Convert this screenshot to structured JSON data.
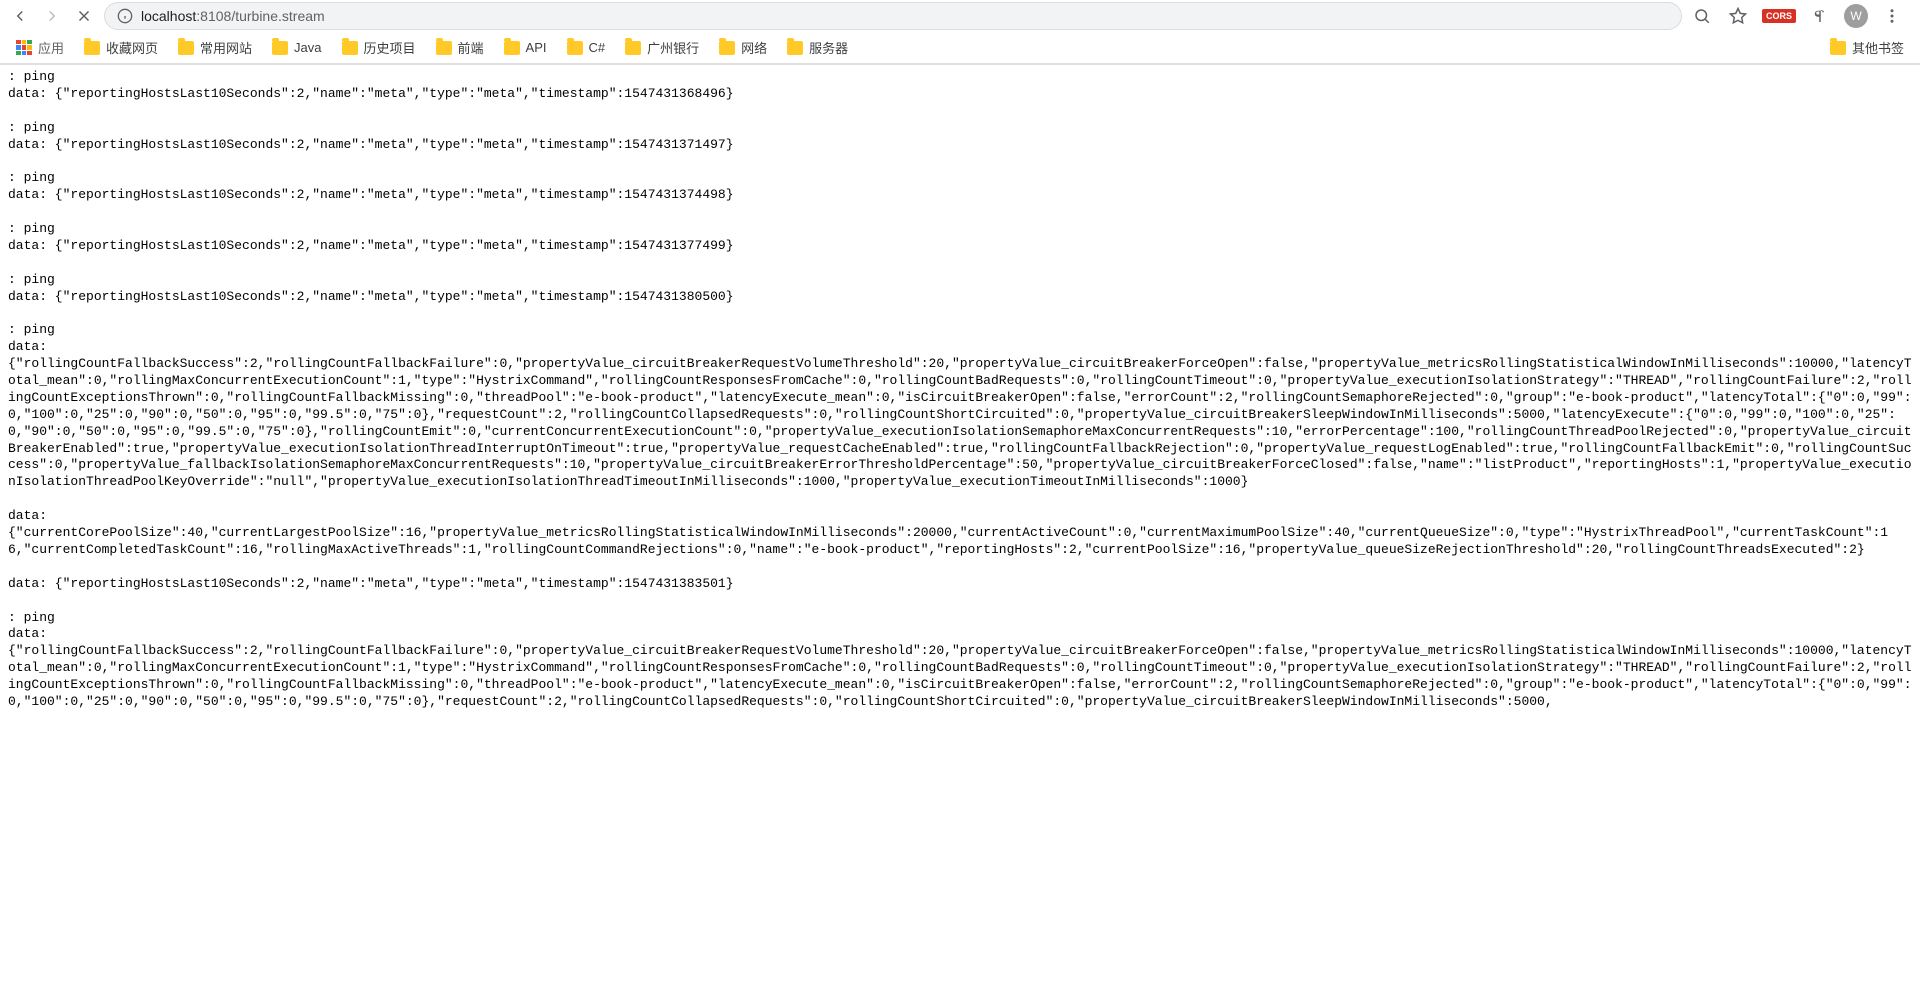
{
  "url": {
    "host": "localhost",
    "port": ":8108",
    "path": "/turbine.stream"
  },
  "toolbar": {
    "cors_label": "CORS",
    "avatar_letter": "W"
  },
  "bookmarks": {
    "apps_label": "应用",
    "items": [
      {
        "label": "收藏网页"
      },
      {
        "label": "常用网站"
      },
      {
        "label": "Java"
      },
      {
        "label": "历史项目"
      },
      {
        "label": "前端"
      },
      {
        "label": "API"
      },
      {
        "label": "C#"
      },
      {
        "label": "广州银行"
      },
      {
        "label": "网络"
      },
      {
        "label": "服务器"
      }
    ],
    "other_label": "其他书签"
  },
  "stream": {
    "lines": [
      ": ping",
      "data: {\"reportingHostsLast10Seconds\":2,\"name\":\"meta\",\"type\":\"meta\",\"timestamp\":1547431368496}",
      "",
      ": ping",
      "data: {\"reportingHostsLast10Seconds\":2,\"name\":\"meta\",\"type\":\"meta\",\"timestamp\":1547431371497}",
      "",
      ": ping",
      "data: {\"reportingHostsLast10Seconds\":2,\"name\":\"meta\",\"type\":\"meta\",\"timestamp\":1547431374498}",
      "",
      ": ping",
      "data: {\"reportingHostsLast10Seconds\":2,\"name\":\"meta\",\"type\":\"meta\",\"timestamp\":1547431377499}",
      "",
      ": ping",
      "data: {\"reportingHostsLast10Seconds\":2,\"name\":\"meta\",\"type\":\"meta\",\"timestamp\":1547431380500}",
      "",
      ": ping",
      "data:",
      "{\"rollingCountFallbackSuccess\":2,\"rollingCountFallbackFailure\":0,\"propertyValue_circuitBreakerRequestVolumeThreshold\":20,\"propertyValue_circuitBreakerForceOpen\":false,\"propertyValue_metricsRollingStatisticalWindowInMilliseconds\":10000,\"latencyTotal_mean\":0,\"rollingMaxConcurrentExecutionCount\":1,\"type\":\"HystrixCommand\",\"rollingCountResponsesFromCache\":0,\"rollingCountBadRequests\":0,\"rollingCountTimeout\":0,\"propertyValue_executionIsolationStrategy\":\"THREAD\",\"rollingCountFailure\":2,\"rollingCountExceptionsThrown\":0,\"rollingCountFallbackMissing\":0,\"threadPool\":\"e-book-product\",\"latencyExecute_mean\":0,\"isCircuitBreakerOpen\":false,\"errorCount\":2,\"rollingCountSemaphoreRejected\":0,\"group\":\"e-book-product\",\"latencyTotal\":{\"0\":0,\"99\":0,\"100\":0,\"25\":0,\"90\":0,\"50\":0,\"95\":0,\"99.5\":0,\"75\":0},\"requestCount\":2,\"rollingCountCollapsedRequests\":0,\"rollingCountShortCircuited\":0,\"propertyValue_circuitBreakerSleepWindowInMilliseconds\":5000,\"latencyExecute\":{\"0\":0,\"99\":0,\"100\":0,\"25\":0,\"90\":0,\"50\":0,\"95\":0,\"99.5\":0,\"75\":0},\"rollingCountEmit\":0,\"currentConcurrentExecutionCount\":0,\"propertyValue_executionIsolationSemaphoreMaxConcurrentRequests\":10,\"errorPercentage\":100,\"rollingCountThreadPoolRejected\":0,\"propertyValue_circuitBreakerEnabled\":true,\"propertyValue_executionIsolationThreadInterruptOnTimeout\":true,\"propertyValue_requestCacheEnabled\":true,\"rollingCountFallbackRejection\":0,\"propertyValue_requestLogEnabled\":true,\"rollingCountFallbackEmit\":0,\"rollingCountSuccess\":0,\"propertyValue_fallbackIsolationSemaphoreMaxConcurrentRequests\":10,\"propertyValue_circuitBreakerErrorThresholdPercentage\":50,\"propertyValue_circuitBreakerForceClosed\":false,\"name\":\"listProduct\",\"reportingHosts\":1,\"propertyValue_executionIsolationThreadPoolKeyOverride\":\"null\",\"propertyValue_executionIsolationThreadTimeoutInMilliseconds\":1000,\"propertyValue_executionTimeoutInMilliseconds\":1000}",
      "",
      "data:",
      "{\"currentCorePoolSize\":40,\"currentLargestPoolSize\":16,\"propertyValue_metricsRollingStatisticalWindowInMilliseconds\":20000,\"currentActiveCount\":0,\"currentMaximumPoolSize\":40,\"currentQueueSize\":0,\"type\":\"HystrixThreadPool\",\"currentTaskCount\":16,\"currentCompletedTaskCount\":16,\"rollingMaxActiveThreads\":1,\"rollingCountCommandRejections\":0,\"name\":\"e-book-product\",\"reportingHosts\":2,\"currentPoolSize\":16,\"propertyValue_queueSizeRejectionThreshold\":20,\"rollingCountThreadsExecuted\":2}",
      "",
      "data: {\"reportingHostsLast10Seconds\":2,\"name\":\"meta\",\"type\":\"meta\",\"timestamp\":1547431383501}",
      "",
      ": ping",
      "data:",
      "{\"rollingCountFallbackSuccess\":2,\"rollingCountFallbackFailure\":0,\"propertyValue_circuitBreakerRequestVolumeThreshold\":20,\"propertyValue_circuitBreakerForceOpen\":false,\"propertyValue_metricsRollingStatisticalWindowInMilliseconds\":10000,\"latencyTotal_mean\":0,\"rollingMaxConcurrentExecutionCount\":1,\"type\":\"HystrixCommand\",\"rollingCountResponsesFromCache\":0,\"rollingCountBadRequests\":0,\"rollingCountTimeout\":0,\"propertyValue_executionIsolationStrategy\":\"THREAD\",\"rollingCountFailure\":2,\"rollingCountExceptionsThrown\":0,\"rollingCountFallbackMissing\":0,\"threadPool\":\"e-book-product\",\"latencyExecute_mean\":0,\"isCircuitBreakerOpen\":false,\"errorCount\":2,\"rollingCountSemaphoreRejected\":0,\"group\":\"e-book-product\",\"latencyTotal\":{\"0\":0,\"99\":0,\"100\":0,\"25\":0,\"90\":0,\"50\":0,\"95\":0,\"99.5\":0,\"75\":0},\"requestCount\":2,\"rollingCountCollapsedRequests\":0,\"rollingCountShortCircuited\":0,\"propertyValue_circuitBreakerSleepWindowInMilliseconds\":5000,"
    ]
  }
}
